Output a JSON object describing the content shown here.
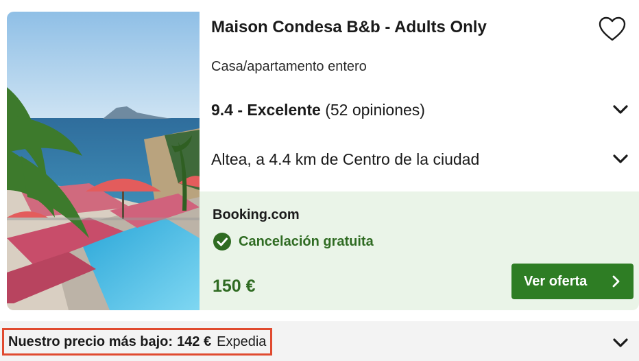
{
  "listing": {
    "title": "Maison Condesa B&b - Adults Only",
    "type": "Casa/apartamento entero",
    "rating_score": "9.4 - Excelente",
    "rating_reviews": "(52 opiniones)",
    "location": "Altea, a 4.4 km de Centro de la ciudad",
    "favorite_icon": "heart-outline-icon",
    "image_alt": "photo-hotel-pool-sea-view"
  },
  "deal": {
    "provider": "Booking.com",
    "cancellation": "Cancelación gratuita",
    "price": "150 €",
    "cta_label": "Ver oferta"
  },
  "lowest_price": {
    "label": "Nuestro precio más bajo:",
    "price": "142 €",
    "site": "Expedia"
  },
  "colors": {
    "deal_background": "#eaf4e8",
    "accent_green": "#2e7d24",
    "price_green": "#2f6b22",
    "highlight_border": "#e04a2f"
  }
}
